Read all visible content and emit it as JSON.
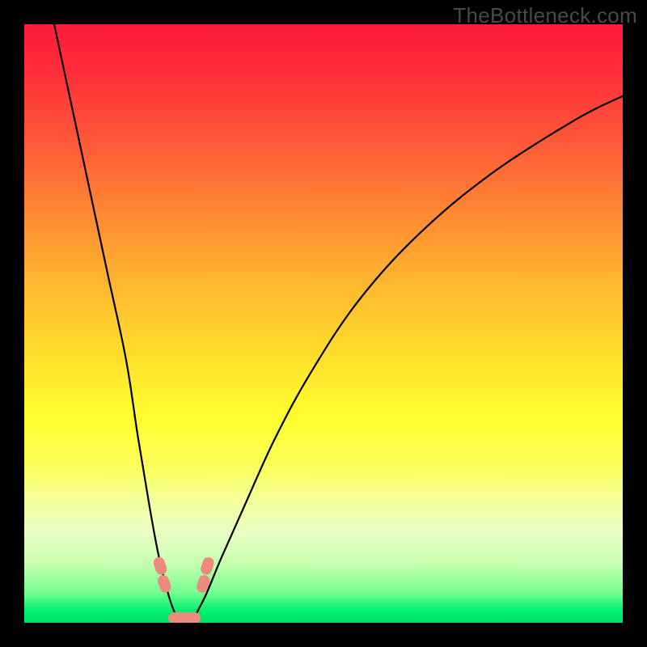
{
  "watermark": "TheBottleneck.com",
  "chart_data": {
    "type": "line",
    "title": "",
    "xlabel": "",
    "ylabel": "",
    "xlim": [
      0,
      100
    ],
    "ylim": [
      0,
      100
    ],
    "grid": false,
    "legend": false,
    "note": "Abstract bottleneck curve: vertical axis encodes bottleneck severity via background color (red=high near top, green=low near bottom). Black curve shows two branches dipping to minimum around x≈24–28. Values estimated from pixel positions; no numeric axes present.",
    "series": [
      {
        "name": "left-branch",
        "x": [
          5,
          8,
          11,
          14,
          17,
          19,
          21,
          22.5,
          24,
          25,
          26
        ],
        "y": [
          100,
          86,
          72,
          58,
          44,
          31,
          19,
          11,
          5,
          2,
          0
        ]
      },
      {
        "name": "right-branch",
        "x": [
          28,
          29,
          30.5,
          33,
          37,
          42,
          48,
          56,
          66,
          78,
          92,
          100
        ],
        "y": [
          0,
          2,
          5,
          11,
          20,
          31,
          42,
          54,
          65,
          75,
          84,
          88
        ]
      }
    ],
    "markers": [
      {
        "name": "left-knee-upper",
        "x": 22.7,
        "y": 9.5
      },
      {
        "name": "left-knee-lower",
        "x": 23.4,
        "y": 6.5
      },
      {
        "name": "right-knee-upper",
        "x": 30.6,
        "y": 9.5
      },
      {
        "name": "right-knee-lower",
        "x": 29.9,
        "y": 6.5
      },
      {
        "name": "valley-left",
        "x": 25.0,
        "y": 0.8
      },
      {
        "name": "valley-right",
        "x": 28.5,
        "y": 0.8
      }
    ],
    "valley_bar": {
      "x_start": 25.0,
      "x_end": 28.5,
      "y": 0.8
    }
  },
  "colors": {
    "gradient_top": "#ff1a3a",
    "gradient_bottom": "#00e060",
    "curve": "#000000",
    "marker": "#ee8b7e",
    "frame": "#000000"
  }
}
